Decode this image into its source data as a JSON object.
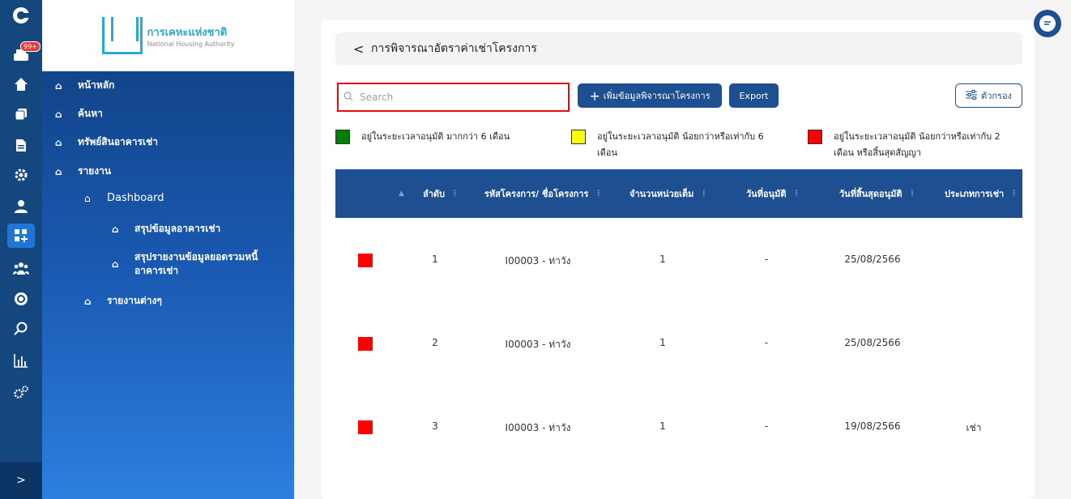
{
  "rail": {
    "badge": "99+",
    "icons": [
      "app-logo-icon",
      "inbox-icon",
      "home-icon",
      "copy-icon",
      "document-icon",
      "settings-icon",
      "user-icon",
      "dashboard-icon",
      "group-icon",
      "badge-icon",
      "search-icon",
      "chart-icon",
      "gears-icon"
    ],
    "expand": ">"
  },
  "logo": {
    "th": "การเคหะแห่งชาติ",
    "en": "National Housing Authority"
  },
  "nav": {
    "home": "หน้าหลัก",
    "search": "ค้นหา",
    "assets": "ทรัพย์สินอาคารเช่า",
    "report": "รายงาน",
    "dashboard": "Dashboard",
    "summary": "สรุปข้อมูลอาคารเช่า",
    "debt_line1": "สรุปรายงานข้อมูลยอดรวมหนี้",
    "debt_line2": "อาคารเช่า",
    "other": "รายงานต่างๆ"
  },
  "page": {
    "title": "การพิจารณาอัตราค่าเช่าโครงการ",
    "back": "<"
  },
  "search": {
    "placeholder": "Search"
  },
  "buttons": {
    "add": "เพิ่มข้อมูลพิจารณาโครงการ",
    "export": "Export",
    "filter": "ตัวกรอง"
  },
  "legend": {
    "green": "อยู่ในระยะเวลาอนุมัติ มากกว่า 6 เดือน",
    "yellow_l1": "อยู่ในระยะเวลาอนุมัติ น้อยกว่าหรือเท่ากับ 6",
    "yellow_l2": "เดือน",
    "red_l1": "อยู่ในระยะเวลาอนุมัติ น้อยกว่าหรือเท่ากับ 2",
    "red_l2": "เดือน หรือสิ้นสุดสัญญา",
    "colors": {
      "green": "#008000",
      "yellow": "#ffff00",
      "red": "#ff0000"
    }
  },
  "table": {
    "headers": {
      "order": "ลำดับ",
      "project": "รหัสโครงการ/ ชื่อโครงการ",
      "units": "จำนวนหน่วยเต็ม",
      "approved": "วันที่อนุมัติ",
      "end": "วันที่สิ้นสุดอนุมัติ",
      "type": "ประเภทการเช่า"
    },
    "rows": [
      {
        "no": "1",
        "project": "I00003 - ท่าวัง",
        "units": "1",
        "approved": "-",
        "end": "25/08/2566",
        "type": ""
      },
      {
        "no": "2",
        "project": "I00003 - ท่าวัง",
        "units": "1",
        "approved": "-",
        "end": "25/08/2566",
        "type": ""
      },
      {
        "no": "3",
        "project": "I00003 - ท่าวัง",
        "units": "1",
        "approved": "-",
        "end": "19/08/2566",
        "type": "เช่า"
      }
    ]
  }
}
